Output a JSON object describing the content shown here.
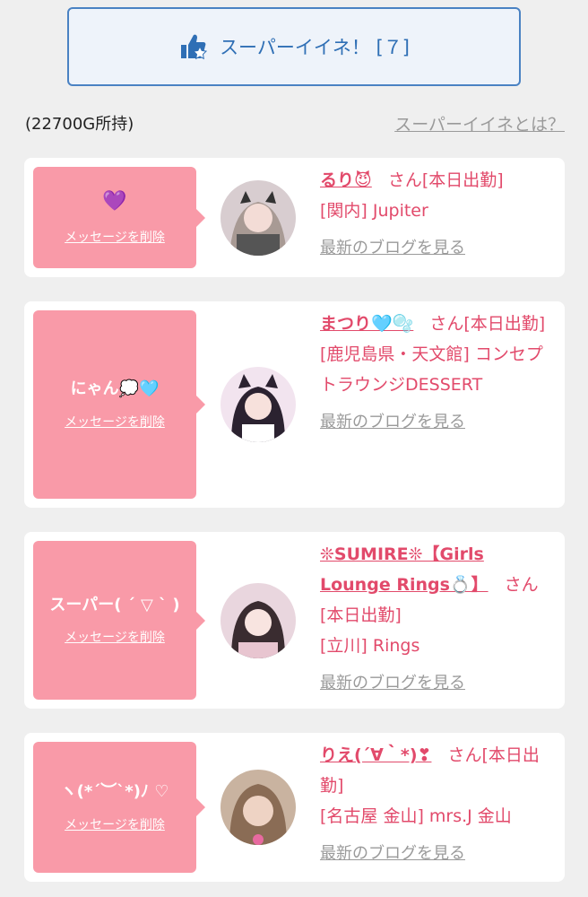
{
  "super_button": {
    "label": "スーパーイイネ！ [７]",
    "icon": "thumbs-up-star-icon",
    "color": "#2f6fb5"
  },
  "owned_text": "(22700G所持)",
  "what_link": "スーパーイイネとは？",
  "bubble_color": "#f99aa8",
  "accent_color": "#e24a6b",
  "entries": [
    {
      "message": "💜",
      "delete_label": "メッセージを削除",
      "name": "るり😈",
      "san_text": "さん[本日出勤]",
      "area": "[関内] Jupiter",
      "blog": "最新のブログを見る"
    },
    {
      "message": "にゃん💭🩵",
      "delete_label": "メッセージを削除",
      "name": "まつり🩵🫧",
      "san_text": "さん[本日出勤]",
      "area": "[鹿児島県・天文館] コンセプトラウンジDESSERT",
      "blog": "最新のブログを見る"
    },
    {
      "message": "スーパー( ´ ▽ ` )",
      "delete_label": "メッセージを削除",
      "name": "❊SUMIRE❊【Girls Lounge Rings💍】",
      "san_text": "さん[本日出勤]",
      "area": "[立川] Rings",
      "blog": "最新のブログを見る"
    },
    {
      "message": "ヽ(*´︶`*)ﾉ ♡",
      "delete_label": "メッセージを削除",
      "name": "りえ(´∀｀*)❣",
      "san_text": "さん[本日出勤]",
      "area": "[名古屋 金山] mrs.J 金山",
      "blog": "最新のブログを見る"
    }
  ]
}
